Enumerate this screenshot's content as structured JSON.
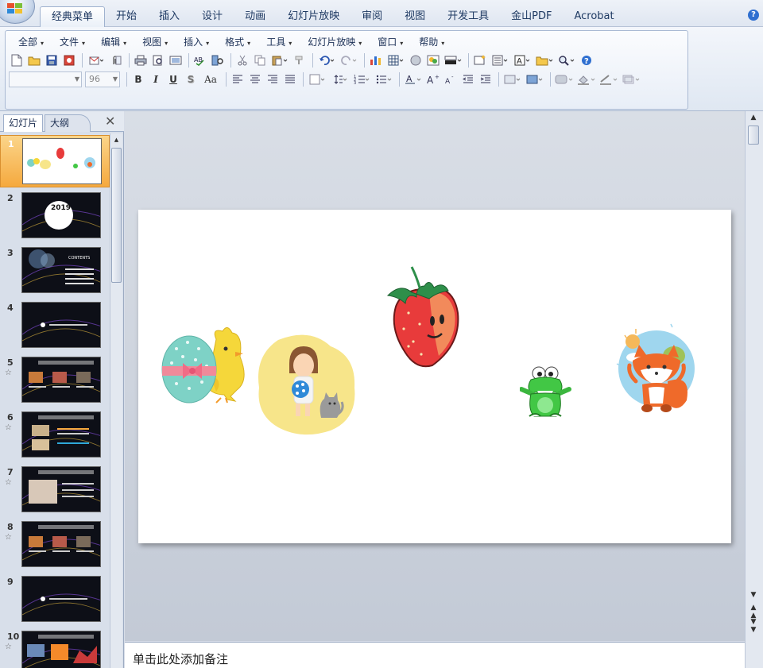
{
  "tabs": [
    {
      "label": "经典菜单",
      "active": true
    },
    {
      "label": "开始"
    },
    {
      "label": "插入"
    },
    {
      "label": "设计"
    },
    {
      "label": "动画"
    },
    {
      "label": "幻灯片放映"
    },
    {
      "label": "审阅"
    },
    {
      "label": "视图"
    },
    {
      "label": "开发工具"
    },
    {
      "label": "金山PDF"
    },
    {
      "label": "Acrobat"
    }
  ],
  "menus": [
    "全部",
    "文件",
    "编辑",
    "视图",
    "插入",
    "格式",
    "工具",
    "幻灯片放映",
    "窗口",
    "帮助"
  ],
  "format": {
    "font_size": "96",
    "bold": "B",
    "italic": "I",
    "underline": "U",
    "shadow": "S",
    "change_case": "Aa"
  },
  "help_label": "?",
  "pane": {
    "tab_slides": "幻灯片",
    "tab_outline": "大纲",
    "close": "✕"
  },
  "thumbs": [
    {
      "num": "1",
      "selected": true,
      "star": ""
    },
    {
      "num": "2",
      "star": "",
      "text": "2019"
    },
    {
      "num": "3",
      "star": "",
      "text": "CONTENTS"
    },
    {
      "num": "4",
      "star": ""
    },
    {
      "num": "5",
      "star": "☆"
    },
    {
      "num": "6",
      "star": "☆"
    },
    {
      "num": "7",
      "star": "☆"
    },
    {
      "num": "8",
      "star": "☆"
    },
    {
      "num": "9",
      "star": ""
    },
    {
      "num": "10",
      "star": "☆"
    }
  ],
  "notes_placeholder": "单击此处添加备注",
  "colors": {
    "accent_orange": "#f5a93e",
    "ribbon_blue": "#dfe7f2",
    "slide_bg": "#ffffff",
    "dark_thumb": "#0d0f17"
  }
}
